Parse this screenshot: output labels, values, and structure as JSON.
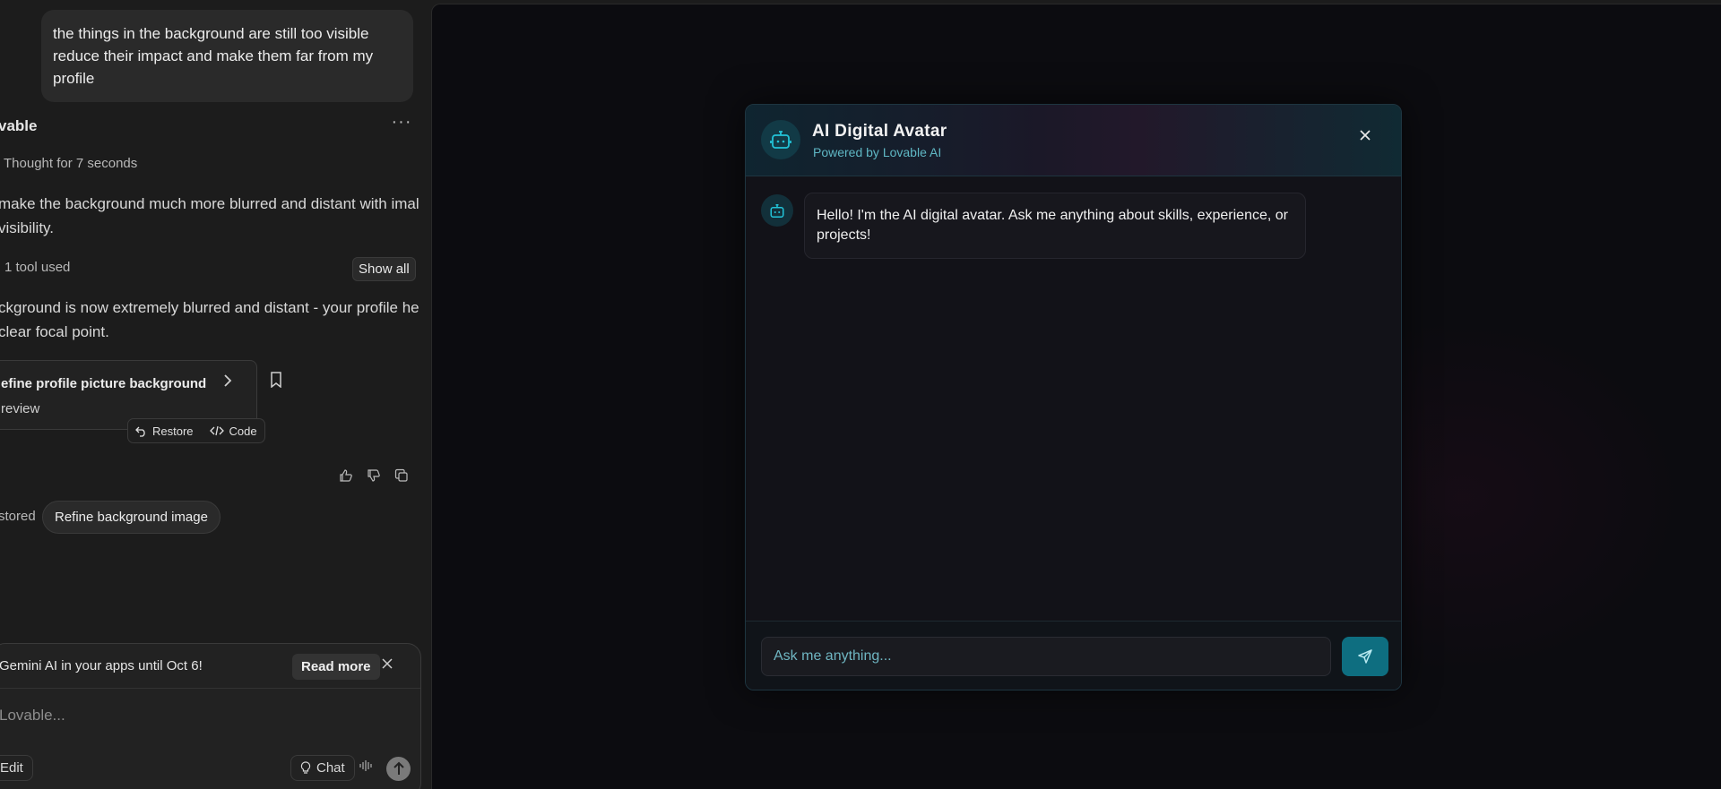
{
  "chat": {
    "user_message": "the things in the background are still too visible reduce their impact and make them far from my profile",
    "agent_name": "vable",
    "thought": "Thought for 7 seconds",
    "response_1": "make the background much more blurred and distant with imal visibility.",
    "tools_used": "1 tool used",
    "show_all": "Show all",
    "response_2": "ckground is now extremely blurred and distant - your profile he clear focal point.",
    "version_title": "efine profile picture background",
    "version_sub": "review",
    "restore_label": "Restore",
    "code_label": "Code",
    "restored_label": "stored",
    "suggestion_chip": "Refine background image"
  },
  "composer": {
    "notice_text": "Gemini AI in your apps until Oct 6!",
    "read_more": "Read more",
    "placeholder": "Lovable...",
    "edit_label": "Edit",
    "chat_label": "Chat"
  },
  "preview": {
    "modal_title": "AI Digital Avatar",
    "modal_subtitle": "Powered by Lovable AI",
    "bot_message": "Hello! I'm the AI digital avatar. Ask me anything about skills, experience, or projects!",
    "input_placeholder": "Ask me anything..."
  },
  "colors": {
    "accent": "#0e6e80",
    "accent_text": "#5fb7c4",
    "panel_bg": "#1c1c1c",
    "preview_bg": "#0c0c10"
  }
}
